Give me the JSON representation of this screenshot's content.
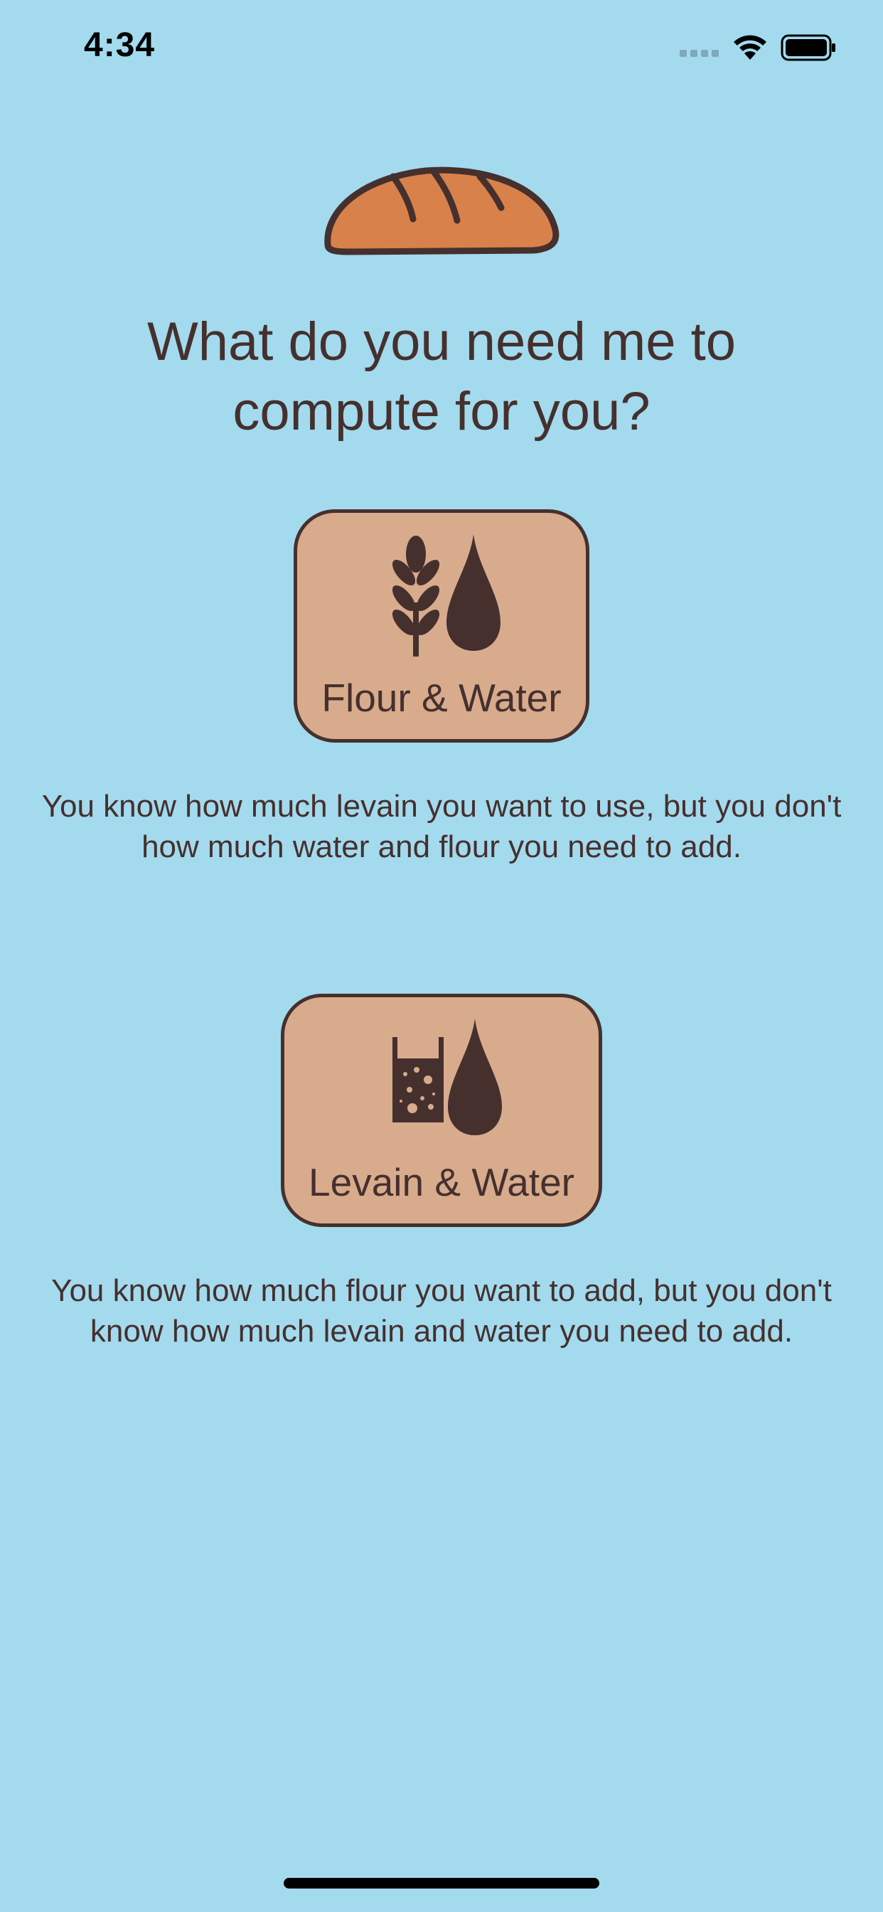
{
  "status_bar": {
    "time": "4:34",
    "icons": [
      "cellular-signal-icon",
      "wifi-icon",
      "battery-icon"
    ]
  },
  "main": {
    "logo_icon": "bread-loaf-icon",
    "headline": "What do you need me to compute for you?",
    "options": [
      {
        "icon": "wheat-and-water-drop-icon",
        "label": "Flour & Water",
        "description": "You know how much levain you want to use, but you don't how much water and flour you need to add."
      },
      {
        "icon": "levain-jar-and-water-drop-icon",
        "label": "Levain & Water",
        "description": "You know how much flour you want to add, but you don't know how much levain and water you need to add."
      }
    ]
  },
  "colors": {
    "background": "#A3DAEE",
    "card_fill": "#D8AB8D",
    "text_and_outline": "#45302E",
    "bread_fill": "#D9814A"
  }
}
